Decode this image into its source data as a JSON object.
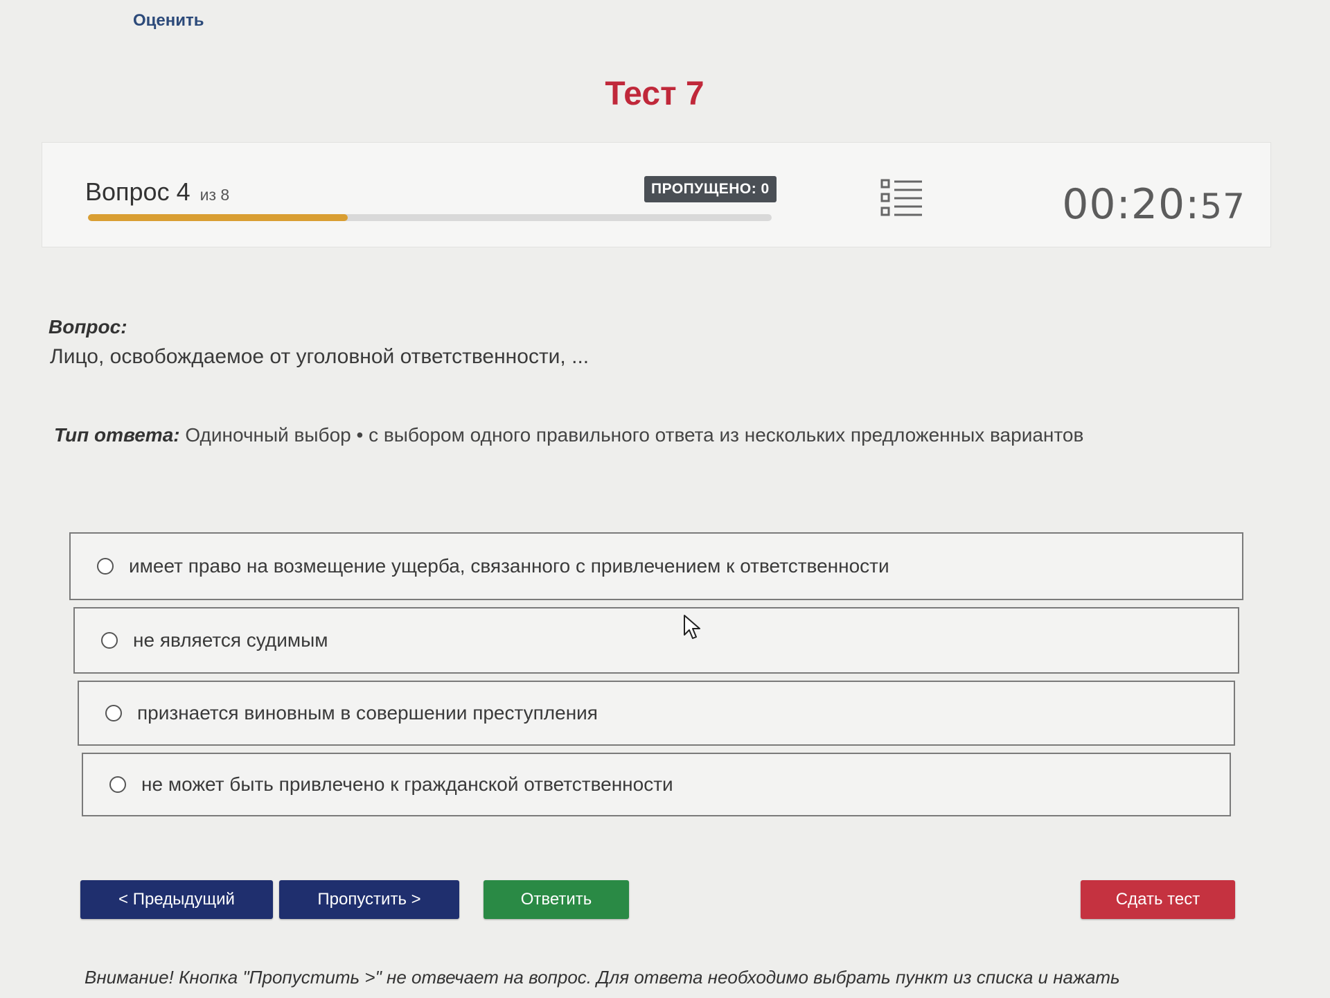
{
  "header": {
    "rate_link": "Оценить",
    "title": "Тест 7"
  },
  "progress": {
    "question_label": "Вопрос 4",
    "of_label": "из 8",
    "current": 4,
    "total": 8,
    "fill_fraction": 0.38,
    "skipped_badge": "ПРОПУЩЕНО: 0",
    "question_list_icon": "list-icon",
    "timer_main": "00:20:",
    "timer_seconds": "57"
  },
  "question": {
    "label": "Вопрос:",
    "text": "Лицо, освобождаемое от уголовной ответственности, ..."
  },
  "answer_type": {
    "label": "Тип ответа:",
    "value": "Одиночный выбор • с выбором одного правильного ответа из нескольких предложенных вариантов"
  },
  "options": [
    {
      "text": "имеет право на возмещение ущерба, связанного с привлечением к ответственности"
    },
    {
      "text": "не является судимым"
    },
    {
      "text": "признается виновным в совершении преступления"
    },
    {
      "text": "не может быть привлечено к гражданской ответственности"
    }
  ],
  "buttons": {
    "prev": "< Предыдущий",
    "skip": "Пропустить >",
    "answer": "Ответить",
    "submit": "Сдать тест"
  },
  "notice": "Внимание! Кнопка \"Пропустить >\" не отвечает на вопрос. Для ответа необходимо выбрать пункт из списка и нажать",
  "colors": {
    "title": "#c0283a",
    "progress_fill": "#d99e32",
    "nav_button": "#1f2f6e",
    "answer_button": "#2a8a45",
    "submit_button": "#c53240",
    "badge": "#4a4f55"
  }
}
